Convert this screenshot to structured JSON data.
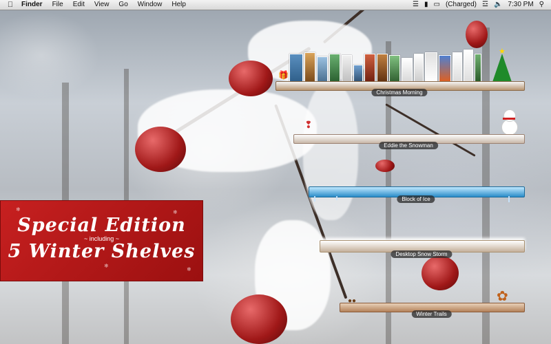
{
  "menubar": {
    "app": "Finder",
    "menus": [
      "File",
      "Edit",
      "View",
      "Go",
      "Window",
      "Help"
    ],
    "battery_status": "(Charged)",
    "time": "7:30 PM"
  },
  "promo": {
    "line1": "Special Edition",
    "line2": "~ including ~",
    "line3": "5 Winter Shelves"
  },
  "shelves": [
    {
      "label": "Christmas Morning"
    },
    {
      "label": "Eddie the Snowman"
    },
    {
      "label": "Block of Ice"
    },
    {
      "label": "Desktop Snow Storm"
    },
    {
      "label": "Winter Trails"
    }
  ],
  "colors": {
    "promo_red": "#c72020",
    "berry_red": "#a01818"
  }
}
